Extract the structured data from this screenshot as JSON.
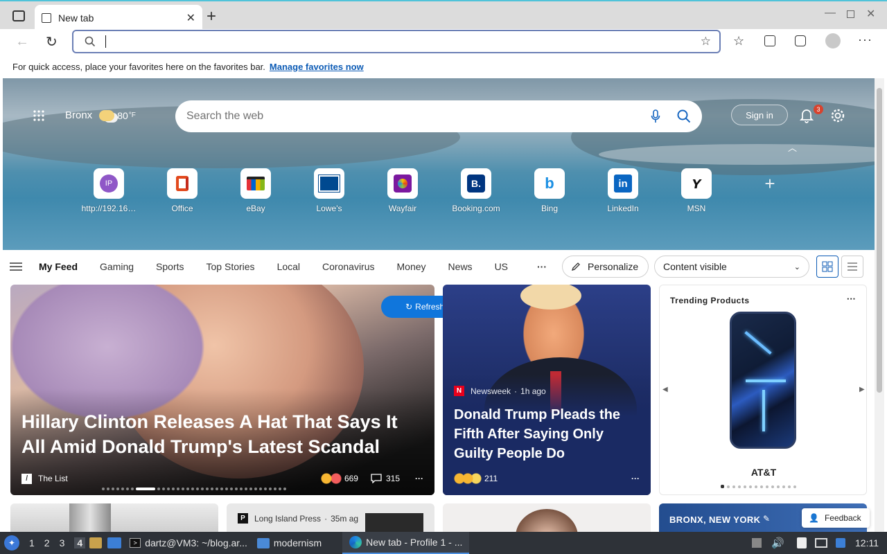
{
  "browser": {
    "tab_title": "New tab",
    "address_placeholder": "",
    "favbar_text": "For quick access, place your favorites here on the favorites bar.",
    "favbar_link": "Manage favorites now"
  },
  "hero": {
    "location": "Bronx",
    "temperature": "80",
    "temp_unit": "°F",
    "search_placeholder": "Search the web",
    "sign_in": "Sign in",
    "notification_count": "3",
    "quick_links": [
      {
        "label": "http://192.16…",
        "icon": "ip-icon"
      },
      {
        "label": "Office",
        "icon": "office-icon"
      },
      {
        "label": "eBay",
        "icon": "ebay-icon"
      },
      {
        "label": "Lowe's",
        "icon": "lowes-icon"
      },
      {
        "label": "Wayfair",
        "icon": "wayfair-icon"
      },
      {
        "label": "Booking.com",
        "icon": "booking-icon"
      },
      {
        "label": "Bing",
        "icon": "bing-icon"
      },
      {
        "label": "LinkedIn",
        "icon": "linkedin-icon"
      },
      {
        "label": "MSN",
        "icon": "msn-icon"
      }
    ],
    "ip_badge": "IP"
  },
  "feed_nav": {
    "items": [
      "My Feed",
      "Gaming",
      "Sports",
      "Top Stories",
      "Local",
      "Coronavirus",
      "Money",
      "News",
      "US"
    ],
    "more": "···",
    "personalize": "Personalize",
    "content_visible": "Content visible"
  },
  "cards": {
    "refresh": "Refresh stories",
    "big": {
      "headline": "Hillary Clinton Releases A Hat That Says It All Amid Donald Trump's Latest Scandal",
      "source": "The List",
      "reactions": "669",
      "comments": "315"
    },
    "trump": {
      "source": "Newsweek",
      "time": "1h ago",
      "headline": "Donald Trump Pleads the Fifth After Saying Only Guilty People Do",
      "reactions": "211"
    },
    "trending": {
      "title": "Trending Products",
      "product": "AT&T"
    },
    "row2": {
      "source": "Long Island Press",
      "time": "35m ag",
      "weather_location": "BRONX, NEW YORK",
      "feedback": "Feedback"
    }
  },
  "taskbar": {
    "workspaces": [
      "1",
      "2",
      "3",
      "4"
    ],
    "terminal": "dartz@VM3: ~/blog.ar...",
    "folder": "modernism",
    "browser": "New tab - Profile 1 - ...",
    "clock": "12:11"
  },
  "colors": {
    "accent": "#0c5bb5",
    "refresh_bg": "#1076dc",
    "newsweek": "#e8001c"
  }
}
